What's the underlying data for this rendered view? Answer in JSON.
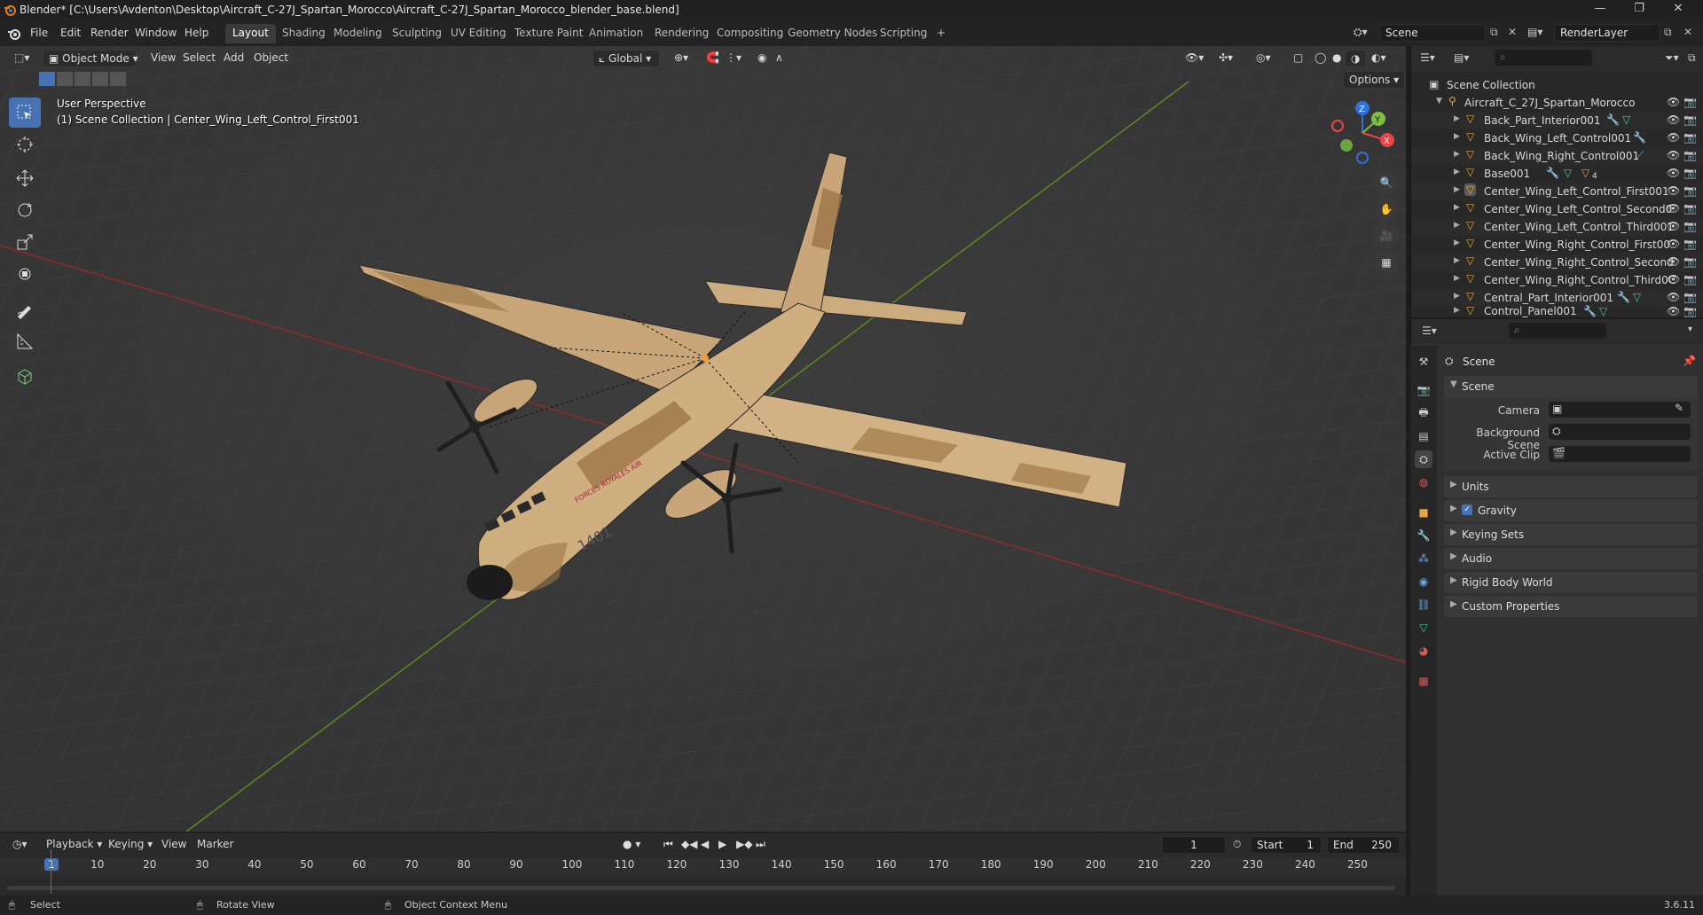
{
  "window": {
    "title": "Blender* [C:\\Users\\Avdenton\\Desktop\\Aircraft_C-27J_Spartan_Morocco\\Aircraft_C-27J_Spartan_Morocco_blender_base.blend]",
    "controls": [
      "—",
      "❐",
      "✕"
    ]
  },
  "menu": [
    "File",
    "Edit",
    "Render",
    "Window",
    "Help"
  ],
  "workspaces": [
    "Layout",
    "Shading",
    "Modeling",
    "Sculpting",
    "UV Editing",
    "Texture Paint",
    "Animation",
    "Rendering",
    "Compositing",
    "Geometry Nodes",
    "Scripting"
  ],
  "active_workspace": "Layout",
  "add_workspace": "+",
  "scene_field": "Scene",
  "renderlayer_field": "RenderLayer",
  "viewport_header": {
    "mode": "Object Mode",
    "menus": [
      "View",
      "Select",
      "Add",
      "Object"
    ],
    "transform_orientation": "Global",
    "options": "Options"
  },
  "viewport_overlay": {
    "perspective": "User Perspective",
    "collection_info": "(1) Scene Collection | Center_Wing_Left_Control_First001",
    "plane_markings": [
      "1401",
      "FORCES ROYALES AIR"
    ]
  },
  "gizmo": {
    "z": "Z",
    "y": "Y",
    "x": "X"
  },
  "outliner": {
    "root": "Scene Collection",
    "collection": "Aircraft_C_27J_Spartan_Morocco",
    "objects": [
      "Back_Part_Interior001",
      "Back_Wing_Left_Control001",
      "Back_Wing_Right_Control001",
      "Base001",
      "Center_Wing_Left_Control_First001",
      "Center_Wing_Left_Control_Second0",
      "Center_Wing_Left_Control_Third001",
      "Center_Wing_Right_Control_First00",
      "Center_Wing_Right_Control_Second",
      "Center_Wing_Right_Control_Third0C",
      "Central_Part_Interior001",
      "Control_Panel001"
    ],
    "base_badge": "4"
  },
  "properties": {
    "context_title": "Scene",
    "section": "Scene",
    "fields": [
      {
        "label": "Camera"
      },
      {
        "label": "Background Scene"
      },
      {
        "label": "Active Clip"
      }
    ],
    "panels": [
      "Units",
      "Gravity",
      "Keying Sets",
      "Audio",
      "Rigid Body World",
      "Custom Properties"
    ]
  },
  "timeline": {
    "menus": [
      "Playback",
      "Keying",
      "View",
      "Marker"
    ],
    "current_frame": "1",
    "start_label": "Start",
    "start": "1",
    "end_label": "End",
    "end": "250",
    "ticks": [
      "1",
      "10",
      "20",
      "30",
      "40",
      "50",
      "60",
      "70",
      "80",
      "90",
      "100",
      "110",
      "120",
      "130",
      "140",
      "150",
      "160",
      "170",
      "180",
      "190",
      "200",
      "210",
      "220",
      "230",
      "240",
      "250"
    ]
  },
  "statusbar": {
    "items": [
      "Select",
      "Rotate View",
      "Object Context Menu"
    ],
    "version": "3.6.11"
  }
}
